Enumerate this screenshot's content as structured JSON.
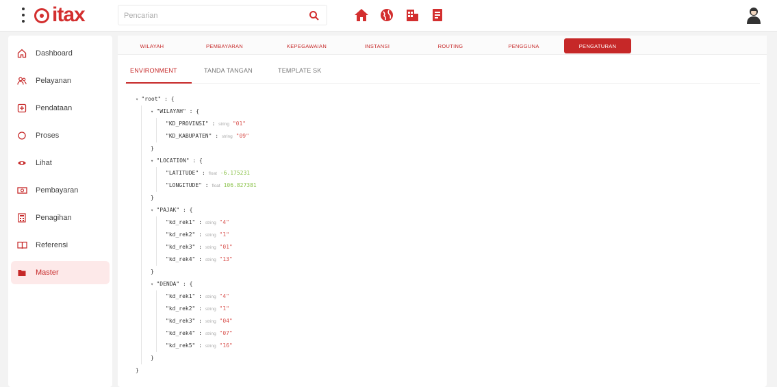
{
  "header": {
    "logo_text": "itax",
    "search": {
      "placeholder": "Pencarian"
    },
    "nav_icons": [
      "home-icon",
      "globe-icon",
      "building-icon",
      "document-icon"
    ]
  },
  "sidebar": {
    "items": [
      {
        "label": "Dashboard",
        "icon": "home-icon"
      },
      {
        "label": "Pelayanan",
        "icon": "users-icon"
      },
      {
        "label": "Pendataan",
        "icon": "add-box-icon"
      },
      {
        "label": "Proses",
        "icon": "circle-icon"
      },
      {
        "label": "Lihat",
        "icon": "eye-icon"
      },
      {
        "label": "Pembayaran",
        "icon": "money-icon"
      },
      {
        "label": "Penagihan",
        "icon": "calculator-icon"
      },
      {
        "label": "Referensi",
        "icon": "book-icon"
      },
      {
        "label": "Master",
        "icon": "folder-icon",
        "active": true
      }
    ]
  },
  "main_tabs": [
    "WILAYAH",
    "PEMBAYARAN",
    "KEPEGAWAIAN",
    "INSTANSI",
    "ROUTING",
    "PENGGUNA",
    "PENGATURAN"
  ],
  "active_main_tab": "PENGATURAN",
  "sub_tabs": [
    "ENVIRONMENT",
    "TANDA TANGAN",
    "TEMPLATE SK"
  ],
  "active_sub_tab": "ENVIRONMENT",
  "json_tree": {
    "root_key": "\"root\"",
    "groups": [
      {
        "key": "\"WILAYAH\"",
        "fields": [
          {
            "key": "\"KD_PROVINSI\"",
            "type": "string",
            "value": "\"01\""
          },
          {
            "key": "\"KD_KABUPATEN\"",
            "type": "string",
            "value": "\"09\""
          }
        ]
      },
      {
        "key": "\"LOCATION\"",
        "fields": [
          {
            "key": "\"LATITUDE\"",
            "type": "float",
            "value": "-6.175231"
          },
          {
            "key": "\"LONGITUDE\"",
            "type": "float",
            "value": "106.827381"
          }
        ]
      },
      {
        "key": "\"PAJAK\"",
        "fields": [
          {
            "key": "\"kd_rek1\"",
            "type": "string",
            "value": "\"4\""
          },
          {
            "key": "\"kd_rek2\"",
            "type": "string",
            "value": "\"1\""
          },
          {
            "key": "\"kd_rek3\"",
            "type": "string",
            "value": "\"01\""
          },
          {
            "key": "\"kd_rek4\"",
            "type": "string",
            "value": "\"13\""
          }
        ]
      },
      {
        "key": "\"DENDA\"",
        "fields": [
          {
            "key": "\"kd_rek1\"",
            "type": "string",
            "value": "\"4\""
          },
          {
            "key": "\"kd_rek2\"",
            "type": "string",
            "value": "\"1\""
          },
          {
            "key": "\"kd_rek3\"",
            "type": "string",
            "value": "\"04\""
          },
          {
            "key": "\"kd_rek4\"",
            "type": "string",
            "value": "\"07\""
          },
          {
            "key": "\"kd_rek5\"",
            "type": "string",
            "value": "\"16\""
          }
        ]
      }
    ]
  },
  "colors": {
    "accent": "#c62828",
    "string_value": "#d9534f",
    "float_value": "#8bc34a"
  }
}
